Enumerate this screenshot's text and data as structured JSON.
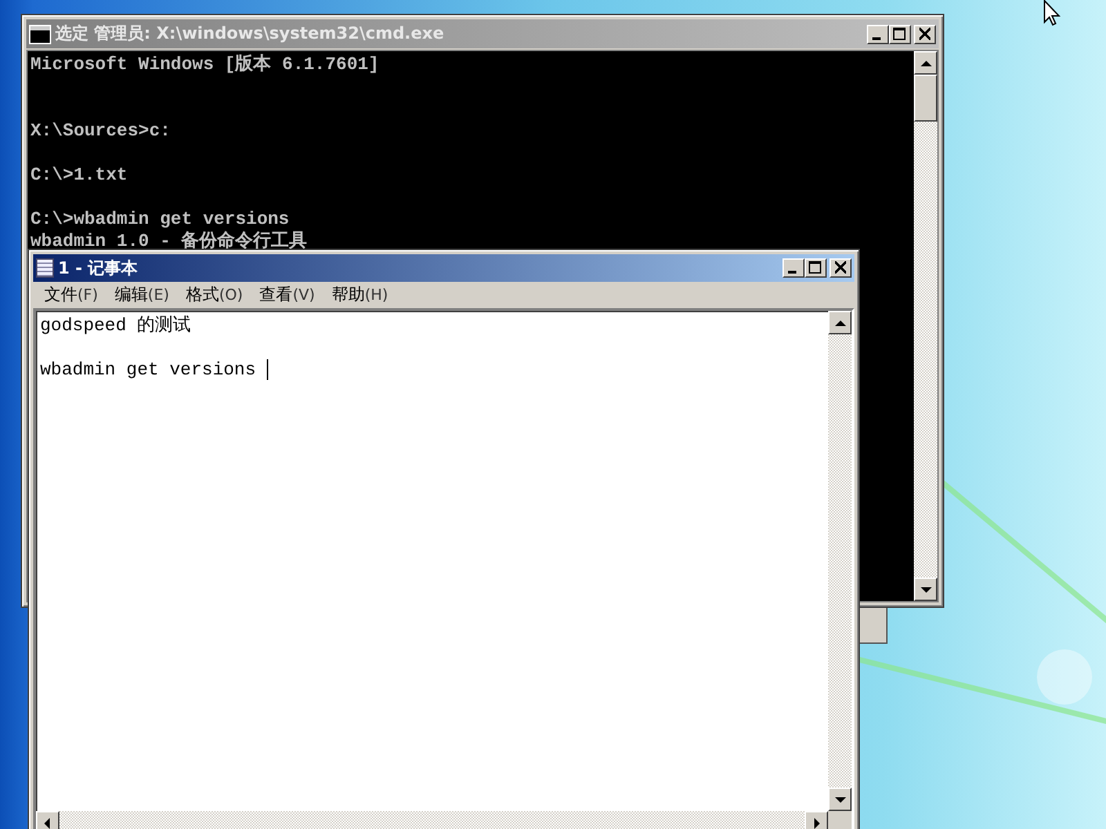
{
  "cmd_window": {
    "title": "选定 管理员: X:\\windows\\system32\\cmd.exe",
    "active": false,
    "output": "Microsoft Windows [版本 6.1.7601]\n\n\nX:\\Sources>c:\n\nC:\\>1.txt\n\nC:\\>wbadmin get versions\nwbadmin 1.0 - 备份命令行工具"
  },
  "notepad_window": {
    "title": "1 - 记事本",
    "active": true,
    "menu": [
      {
        "label": "文件",
        "key": "(F)"
      },
      {
        "label": "编辑",
        "key": "(E)"
      },
      {
        "label": "格式",
        "key": "(O)"
      },
      {
        "label": "查看",
        "key": "(V)"
      },
      {
        "label": "帮助",
        "key": "(H)"
      }
    ],
    "text": "godspeed 的测试\n\nwbadmin get versions "
  }
}
